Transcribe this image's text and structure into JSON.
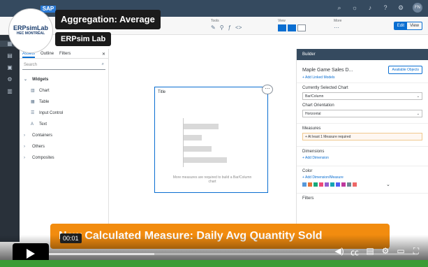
{
  "app": {
    "logo_text": "SAP",
    "model_title": "Maple Game Sales D...",
    "toolbar_tools_label": "Tools",
    "toolbar_view_label": "View",
    "toolbar_more_label": "More",
    "edit_label": "Edit",
    "view_label": "View"
  },
  "outline": {
    "tabs": [
      "Assets",
      "Outline",
      "Filters"
    ],
    "search_placeholder": "Search",
    "widgets_header": "Widgets",
    "widgets": [
      "Chart",
      "Table",
      "Input Control",
      "Text"
    ],
    "groups": [
      "Containers",
      "Others",
      "Composites"
    ]
  },
  "canvas": {
    "chart_title": "Title",
    "empty_message": "More measures are required to build a Bar/Column chart",
    "placeholder_bars": [
      0.62,
      0.32,
      0.5,
      0.78
    ]
  },
  "builder": {
    "header": "Builder",
    "available_objects": "Available Objects",
    "add_linked_models": "+ Add Linked Models",
    "selected_chart_label": "Currently Selected Chart",
    "selected_chart": "Bar/Column",
    "orientation_label": "Chart Orientation",
    "orientation": "Horizontal",
    "measures_label": "Measures",
    "measures_warning": "+ At least 1 Measure required",
    "dimensions_label": "Dimensions",
    "add_dimension": "+ Add Dimension",
    "color_label": "Color",
    "add_dimension_measure": "+ Add Dimension/Measure",
    "palette": [
      "#5899da",
      "#e8743b",
      "#19a979",
      "#ed4a7b",
      "#945ecf",
      "#13a4b4",
      "#525df4",
      "#bf399e",
      "#6c8893",
      "#ee6868"
    ],
    "filters_label": "Filters"
  },
  "overlay": {
    "video_title": "Aggregation: Average",
    "channel": "ERPsim Lab",
    "logo_line1": "ERPsimLab",
    "logo_line2": "HEC MONTRÉAL",
    "caption": "New Calculated Measure: Daily Avg Quantity Sold",
    "timestamp": "00:01",
    "progress": 0.02,
    "buffered": 0.35
  }
}
